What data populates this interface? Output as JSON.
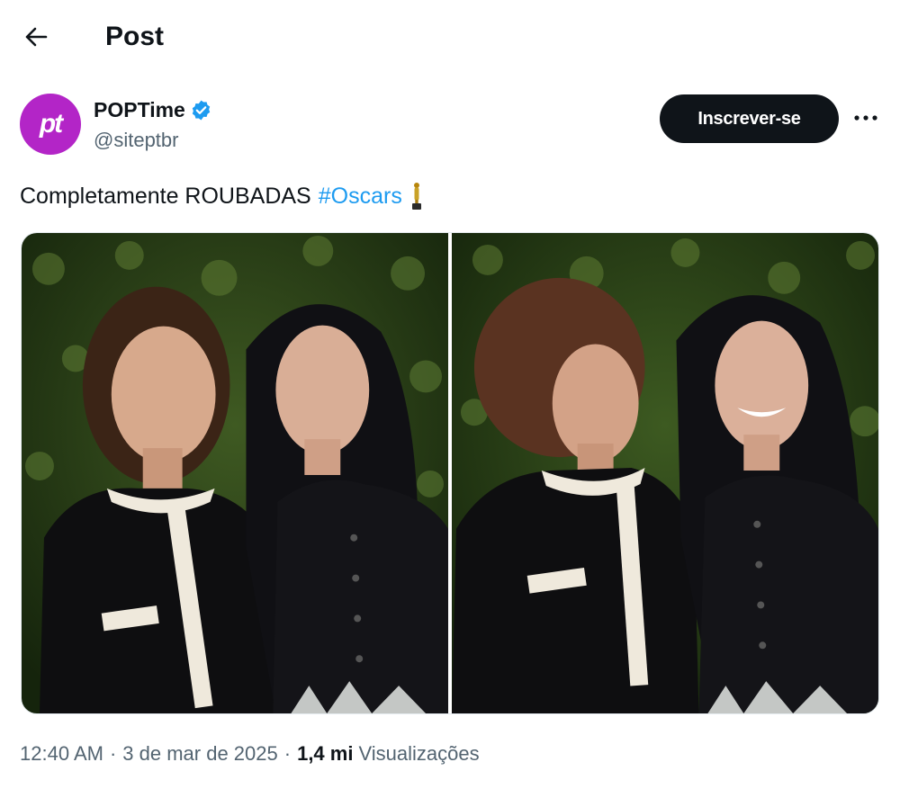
{
  "header": {
    "title": "Post",
    "back_icon": "arrow-left-icon"
  },
  "author": {
    "avatar_text": "pt",
    "avatar_color": "#b325c7",
    "name": "POPTime",
    "handle": "@siteptbr",
    "verified_icon": "verified-badge-icon",
    "verified_color": "#1d9bf0"
  },
  "actions": {
    "subscribe_label": "Inscrever-se",
    "more_icon": "more-horizontal-icon"
  },
  "tweet": {
    "text": "Completamente ROUBADAS",
    "hashtag": "#Oscars",
    "emoji_icon": "oscar-trophy-icon",
    "link_color": "#1d9bf0"
  },
  "media": {
    "count": 2,
    "items": [
      {
        "name": "photo-1"
      },
      {
        "name": "photo-2"
      }
    ]
  },
  "meta": {
    "time": "12:40 AM",
    "separator": "·",
    "date": "3 de mar de 2025",
    "views_count": "1,4 mi",
    "views_label": "Visualizações"
  }
}
